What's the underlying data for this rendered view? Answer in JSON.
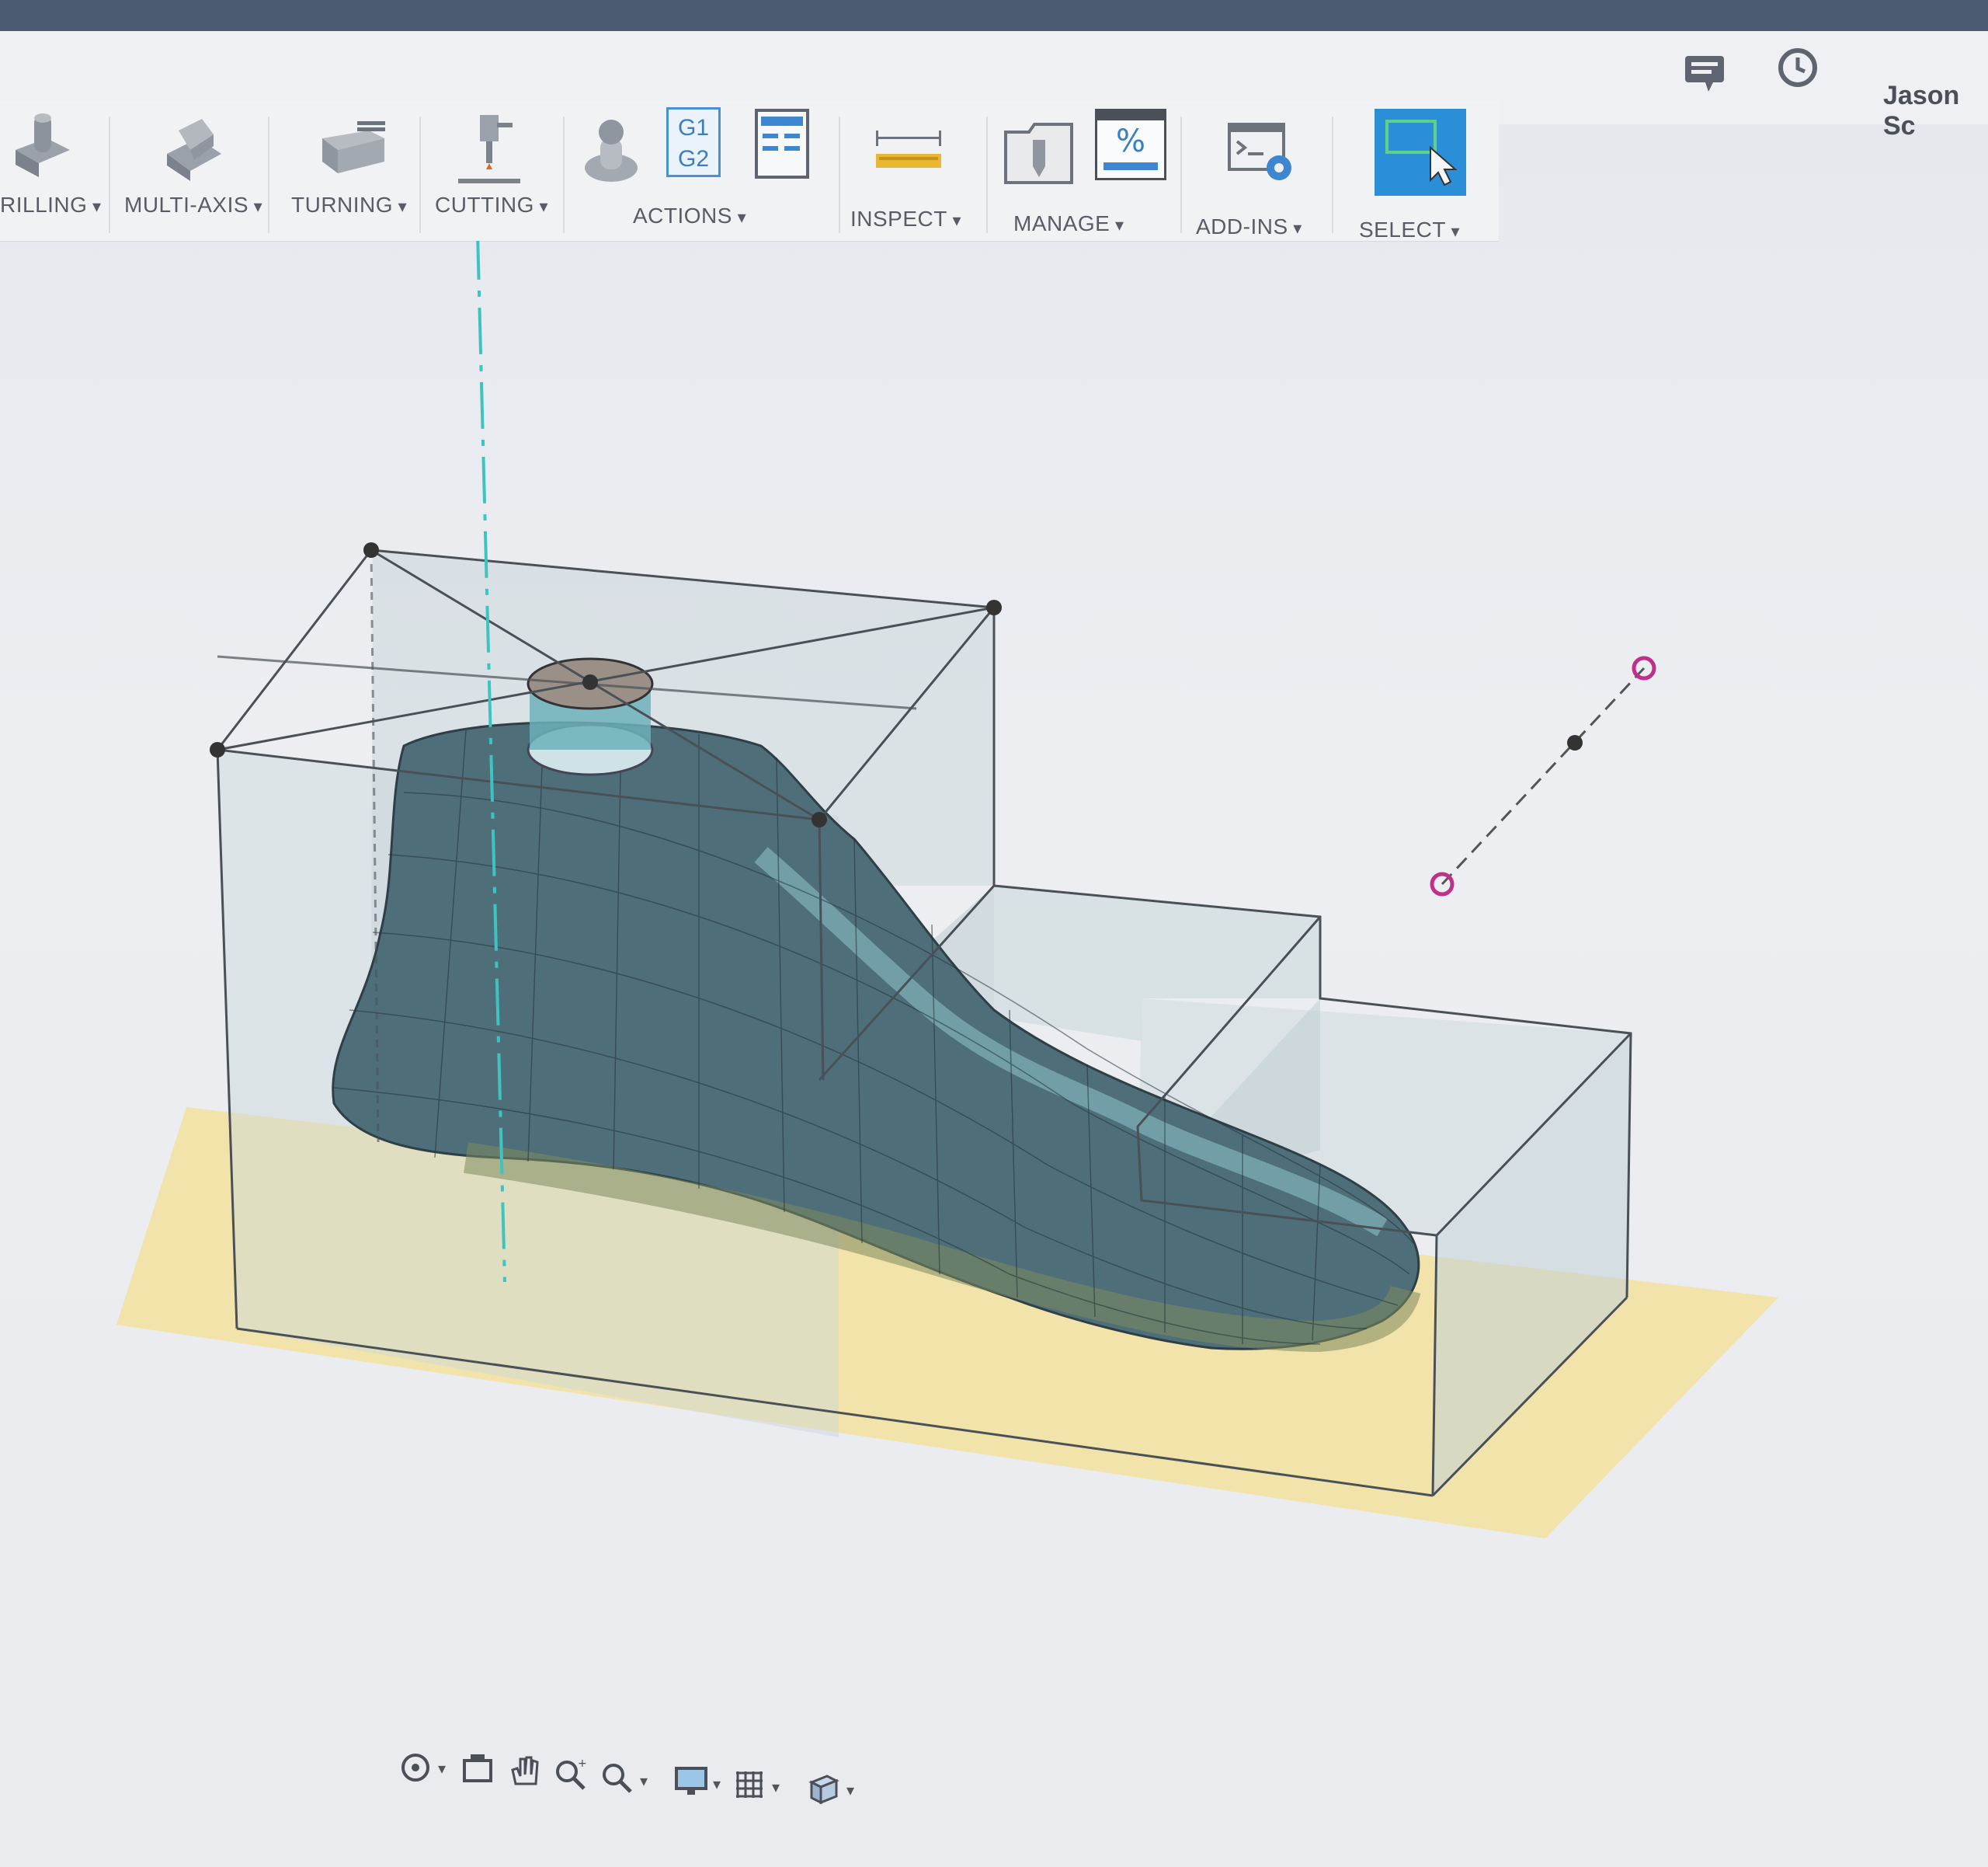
{
  "header": {
    "user_name": "Jason Sc",
    "icons": [
      "comments-icon",
      "clock-icon"
    ]
  },
  "toolbar": {
    "groups": [
      {
        "label": "RILLING",
        "icon": "drilling-icon"
      },
      {
        "label": "MULTI-AXIS",
        "icon": "multi-axis-icon"
      },
      {
        "label": "TURNING",
        "icon": "turning-icon"
      },
      {
        "label": "CUTTING",
        "icon": "cutting-icon"
      },
      {
        "label": "ACTIONS",
        "icon": "actions-icons"
      },
      {
        "label": "INSPECT",
        "icon": "measure-icon"
      },
      {
        "label": "MANAGE",
        "icon": "manage-icons"
      },
      {
        "label": "ADD-INS",
        "icon": "scripts-icon"
      },
      {
        "label": "SELECT",
        "icon": "select-icon"
      }
    ],
    "actions_g_code": [
      "G1",
      "G2"
    ],
    "manage_percent": "%",
    "select_active_color": "#2b8fd8"
  },
  "viewport": {
    "model": "foot-mesh",
    "stock_box_color": "#c8d6da",
    "ground_plane_color": "#f2e3a6",
    "axis_line_color": "#3ec4c0",
    "handle_color": "#c0308a"
  },
  "navbar": {
    "icons": [
      "orbit-icon",
      "look-at-icon",
      "pan-icon",
      "zoom-icon",
      "zoom-window-icon",
      "display-settings-icon",
      "grid-icon",
      "view-cube-icon"
    ]
  }
}
